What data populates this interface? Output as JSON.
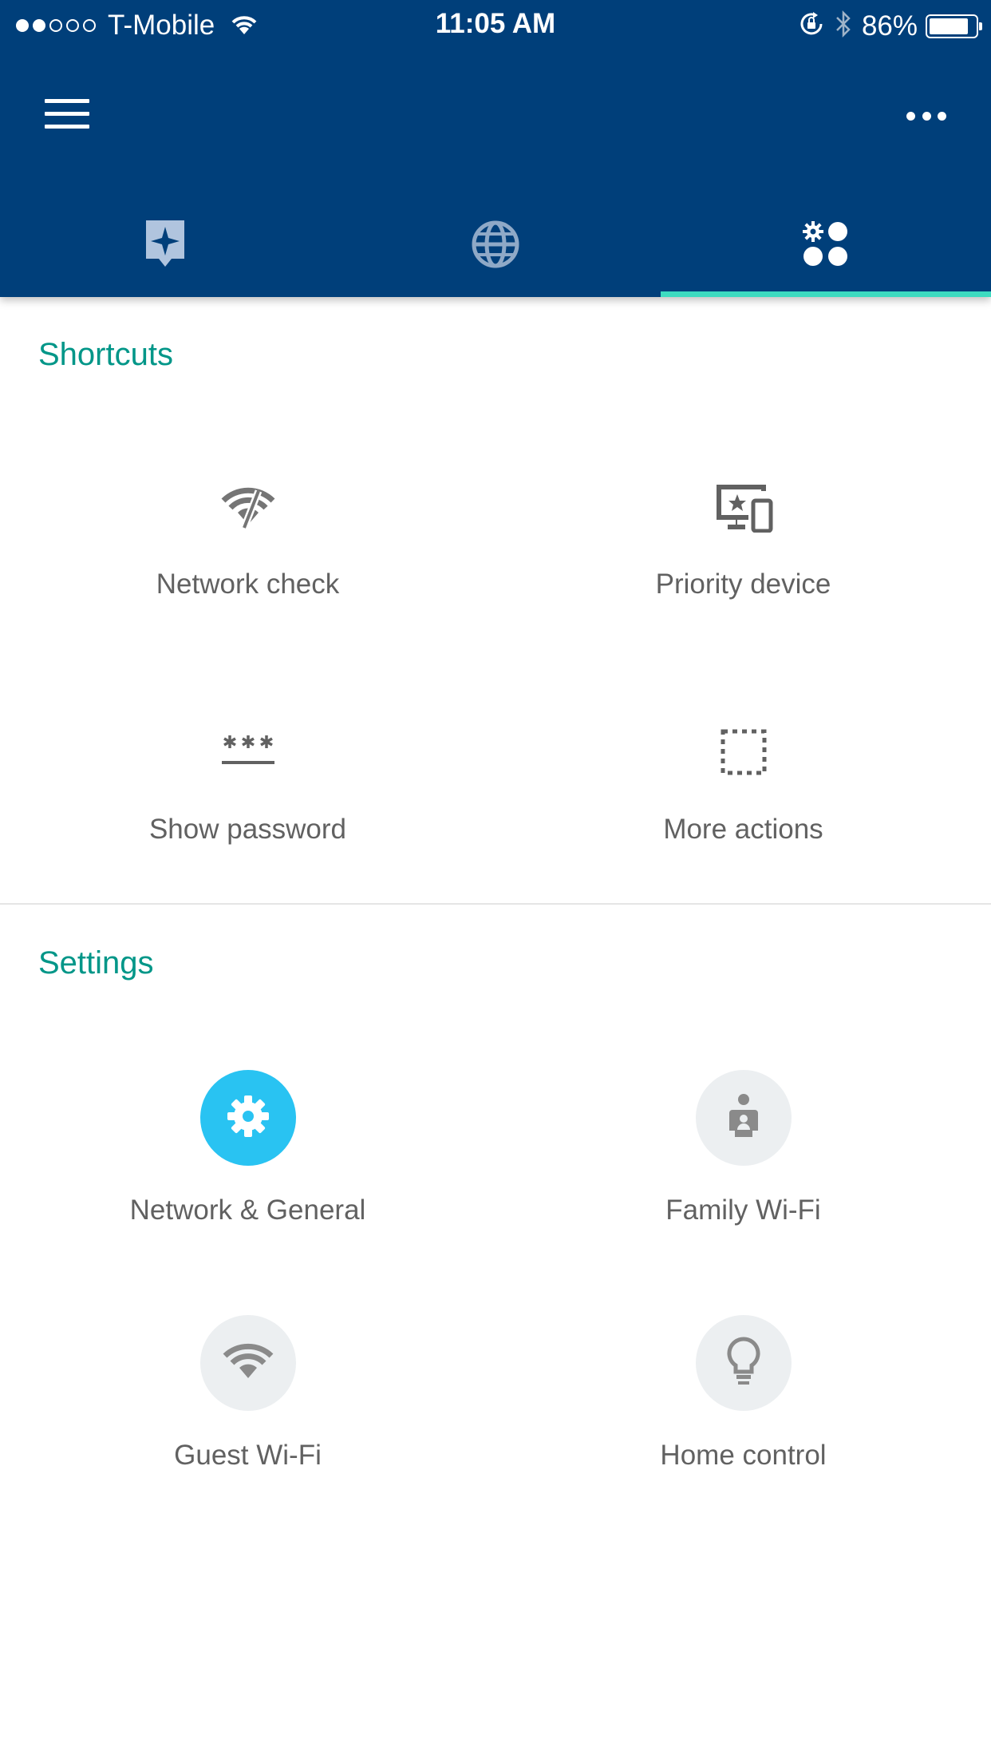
{
  "status_bar": {
    "carrier": "T-Mobile",
    "time": "11:05 AM",
    "battery": "86%",
    "battery_level": 0.86,
    "signal_bars": 2
  },
  "colors": {
    "header": "#003F7A",
    "accent": "#009688",
    "tab_indicator": "#3DDBC0",
    "active_setting": "#29C3F2"
  },
  "tabs": [
    {
      "icon": "sparkle-flag-icon",
      "active": false
    },
    {
      "icon": "globe-icon",
      "active": false
    },
    {
      "icon": "settings-dots-icon",
      "active": true
    }
  ],
  "shortcuts": {
    "title": "Shortcuts",
    "items": [
      {
        "label": "Network check",
        "icon": "network-check-icon"
      },
      {
        "label": "Priority device",
        "icon": "priority-device-icon"
      },
      {
        "label": "Show password",
        "icon": "password-icon"
      },
      {
        "label": "More actions",
        "icon": "more-actions-icon"
      }
    ]
  },
  "settings": {
    "title": "Settings",
    "items": [
      {
        "label": "Network & General",
        "icon": "gear-icon"
      },
      {
        "label": "Family Wi-Fi",
        "icon": "family-icon"
      },
      {
        "label": "Guest Wi-Fi",
        "icon": "wifi-icon"
      },
      {
        "label": "Home control",
        "icon": "lightbulb-icon"
      }
    ]
  }
}
